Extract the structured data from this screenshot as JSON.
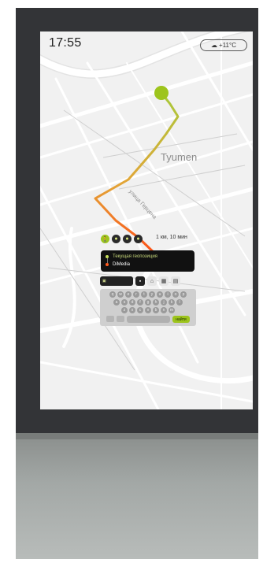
{
  "status": {
    "time": "17:55",
    "weather": "+11°C"
  },
  "map": {
    "city_label": "Tyumen",
    "street_label": "улица Герцена"
  },
  "route": {
    "distance_time": "1 км, 10 мин",
    "from_label": "Текущая геопозиция",
    "to_label": "DiMedia"
  },
  "colors": {
    "start": "#9dc41c",
    "end": "#ff4a14",
    "panel": "#111111"
  },
  "modes": [
    "walk-icon",
    "car-icon",
    "bike-icon",
    "bus-icon"
  ],
  "keyboard": {
    "row1": [
      "q",
      "w",
      "e",
      "r",
      "t",
      "y",
      "u",
      "i",
      "o",
      "p"
    ],
    "row2": [
      "a",
      "s",
      "d",
      "f",
      "g",
      "h",
      "j",
      "k",
      "l"
    ],
    "row3": [
      "z",
      "x",
      "c",
      "v",
      "b",
      "n",
      "m"
    ],
    "go_label": "найти"
  }
}
